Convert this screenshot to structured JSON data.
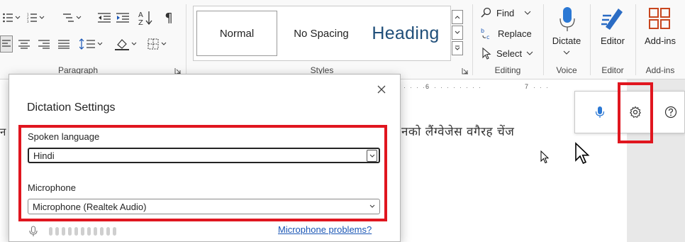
{
  "ribbon": {
    "paragraph_group": {
      "label": "Paragraph"
    },
    "styles_group": {
      "label": "Styles",
      "items": [
        {
          "label": "Normal"
        },
        {
          "label": "No Spacing"
        },
        {
          "label": "Heading"
        }
      ]
    },
    "editing_group": {
      "label": "Editing",
      "find_label": "Find",
      "replace_label": "Replace",
      "select_label": "Select"
    },
    "voice_group": {
      "label": "Voice",
      "dictate_label": "Dictate"
    },
    "editor_group": {
      "label": "Editor",
      "editor_label": "Editor"
    },
    "addins_group": {
      "label": "Add-ins",
      "addins_label": "Add-ins"
    }
  },
  "document": {
    "ruler_marks": [
      "6",
      "7"
    ],
    "visible_text": "नको लैंग्वेजेस वगैरह चेंज",
    "left_fragment": "न"
  },
  "dialog": {
    "title": "Dictation Settings",
    "spoken_language": {
      "label": "Spoken language",
      "value": "Hindi"
    },
    "microphone": {
      "label": "Microphone",
      "value": "Microphone (Realtek Audio)"
    },
    "microphone_problems_link": "Microphone problems?"
  },
  "colors": {
    "highlight": "#e0161f",
    "accent": "#1a56b5",
    "heading": "#1f4e79"
  },
  "icons": {
    "dictate": "microphone-icon",
    "settings": "gear-icon",
    "help": "help-icon",
    "close": "close-icon"
  }
}
